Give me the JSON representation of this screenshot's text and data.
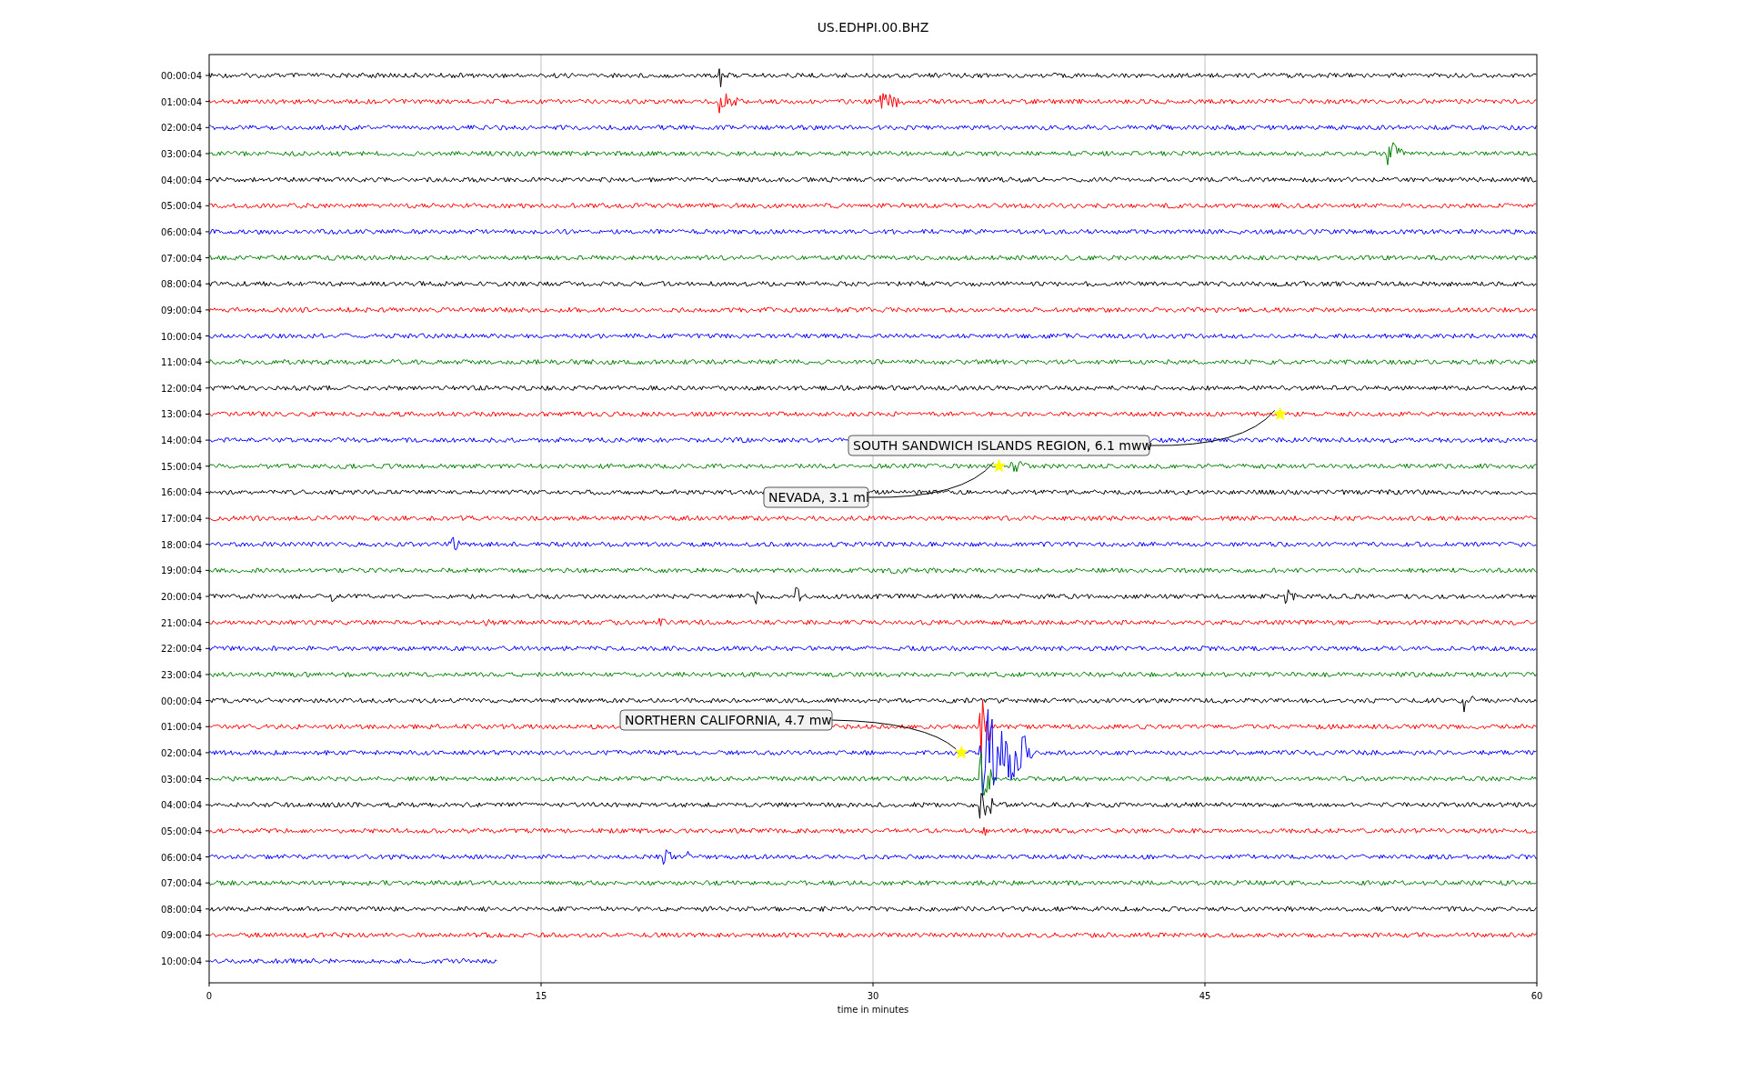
{
  "title": "US.EDHPI.00.BHZ",
  "xlabel": "time in minutes",
  "xticks": [
    "0",
    "15",
    "30",
    "45",
    "60"
  ],
  "rows": [
    {
      "label": "00:00:04",
      "color": "#000000",
      "level": 1
    },
    {
      "label": "01:00:04",
      "color": "#ff0000",
      "level": 1
    },
    {
      "label": "02:00:04",
      "color": "#0000ff",
      "level": 1
    },
    {
      "label": "03:00:04",
      "color": "#008000",
      "level": 1
    },
    {
      "label": "04:00:04",
      "color": "#000000",
      "level": 1
    },
    {
      "label": "05:00:04",
      "color": "#ff0000",
      "level": 1
    },
    {
      "label": "06:00:04",
      "color": "#0000ff",
      "level": 1
    },
    {
      "label": "07:00:04",
      "color": "#008000",
      "level": 1
    },
    {
      "label": "08:00:04",
      "color": "#000000",
      "level": 1
    },
    {
      "label": "09:00:04",
      "color": "#ff0000",
      "level": 1
    },
    {
      "label": "10:00:04",
      "color": "#0000ff",
      "level": 1
    },
    {
      "label": "11:00:04",
      "color": "#008000",
      "level": 1
    },
    {
      "label": "12:00:04",
      "color": "#000000",
      "level": 1
    },
    {
      "label": "13:00:04",
      "color": "#ff0000",
      "level": 1
    },
    {
      "label": "14:00:04",
      "color": "#0000ff",
      "level": 1
    },
    {
      "label": "15:00:04",
      "color": "#008000",
      "level": 1
    },
    {
      "label": "16:00:04",
      "color": "#000000",
      "level": 1
    },
    {
      "label": "17:00:04",
      "color": "#ff0000",
      "level": 1
    },
    {
      "label": "18:00:04",
      "color": "#0000ff",
      "level": 1
    },
    {
      "label": "19:00:04",
      "color": "#008000",
      "level": 1
    },
    {
      "label": "20:00:04",
      "color": "#000000",
      "level": 1
    },
    {
      "label": "21:00:04",
      "color": "#ff0000",
      "level": 1
    },
    {
      "label": "22:00:04",
      "color": "#0000ff",
      "level": 1
    },
    {
      "label": "23:00:04",
      "color": "#008000",
      "level": 1
    },
    {
      "label": "00:00:04",
      "color": "#000000",
      "level": 1
    },
    {
      "label": "01:00:04",
      "color": "#ff0000",
      "level": 1
    },
    {
      "label": "02:00:04",
      "color": "#0000ff",
      "level": 1
    },
    {
      "label": "03:00:04",
      "color": "#008000",
      "level": 1
    },
    {
      "label": "04:00:04",
      "color": "#000000",
      "level": 1
    },
    {
      "label": "05:00:04",
      "color": "#ff0000",
      "level": 1
    },
    {
      "label": "06:00:04",
      "color": "#0000ff",
      "level": 1
    },
    {
      "label": "07:00:04",
      "color": "#008000",
      "level": 1
    },
    {
      "label": "08:00:04",
      "color": "#000000",
      "level": 1
    },
    {
      "label": "09:00:04",
      "color": "#ff0000",
      "level": 1
    },
    {
      "label": "10:00:04",
      "color": "#0000ff",
      "level": 0.217
    }
  ],
  "events": [
    {
      "label": "SOUTH SANDWICH ISLANDS REGION, 6.1 mww"
    },
    {
      "label": "NEVADA, 3.1 ml"
    },
    {
      "label": "NORTHERN CALIFORNIA, 4.7 mw"
    }
  ]
}
